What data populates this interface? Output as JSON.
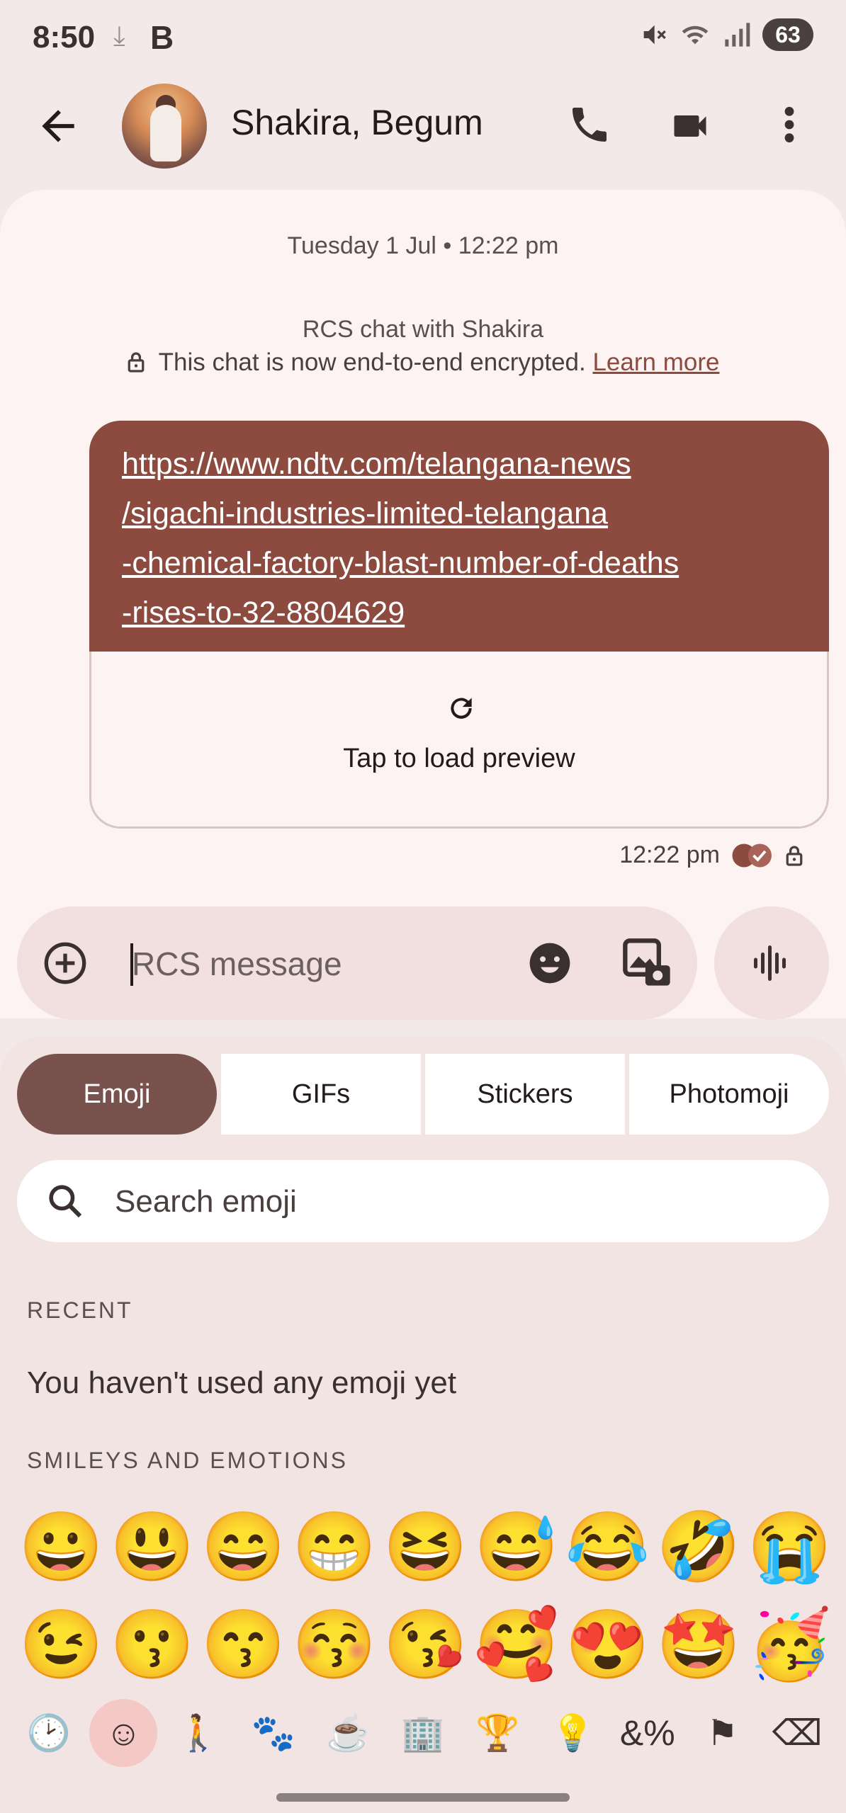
{
  "status_bar": {
    "time": "8:50",
    "download_glyph": "⤓",
    "app_badge": "B",
    "battery": "63",
    "icons": [
      "mute-icon",
      "wifi-icon",
      "signal-icon"
    ]
  },
  "header": {
    "contact_name": "Shakira, Begum",
    "icons": [
      "back-arrow-icon",
      "phone-icon",
      "video-icon",
      "more-vert-icon"
    ]
  },
  "chat": {
    "date_header": "Tuesday 1 Jul • 12:22 pm",
    "rcs_title": "RCS chat with Shakira",
    "encryption_text": "This chat is now end-to-end encrypted.",
    "learn_more": "Learn more",
    "message": {
      "link_lines": [
        "https://www.ndtv.com/telangana-news",
        "/sigachi-industries-limited-telangana",
        "-chemical-factory-blast-number-of-deaths",
        "-rises-to-32-8804629"
      ],
      "preview_label": "Tap to load preview",
      "time": "12:22 pm"
    }
  },
  "compose": {
    "placeholder": "RCS message"
  },
  "emoji_panel": {
    "tabs": [
      "Emoji",
      "GIFs",
      "Stickers",
      "Photomoji"
    ],
    "active_tab": "Emoji",
    "search_placeholder": "Search emoji",
    "recent_heading": "RECENT",
    "recent_empty": "You haven't used any emoji yet",
    "smileys_heading": "SMILEYS AND EMOTIONS",
    "emojis": [
      "😀",
      "😃",
      "😄",
      "😁",
      "😆",
      "😅",
      "😂",
      "🤣",
      "😭",
      "😉",
      "😗",
      "😙",
      "😚",
      "😘",
      "🥰",
      "😍",
      "🤩",
      "🥳"
    ],
    "categories": [
      {
        "name": "recent-category-icon",
        "glyph": "🕑"
      },
      {
        "name": "smileys-category-icon",
        "glyph": "☺"
      },
      {
        "name": "people-category-icon",
        "glyph": "🚶"
      },
      {
        "name": "animals-category-icon",
        "glyph": "🐾"
      },
      {
        "name": "food-category-icon",
        "glyph": "☕"
      },
      {
        "name": "travel-category-icon",
        "glyph": "🏢"
      },
      {
        "name": "activities-category-icon",
        "glyph": "🏆"
      },
      {
        "name": "objects-category-icon",
        "glyph": "💡"
      },
      {
        "name": "symbols-category-icon",
        "glyph": "&%"
      },
      {
        "name": "flags-category-icon",
        "glyph": "⚑"
      },
      {
        "name": "backspace-icon",
        "glyph": "⌫"
      }
    ]
  },
  "colors": {
    "accent": "#8d4a3f",
    "active_tab": "#7a524d",
    "background": "#f4e9e9"
  }
}
